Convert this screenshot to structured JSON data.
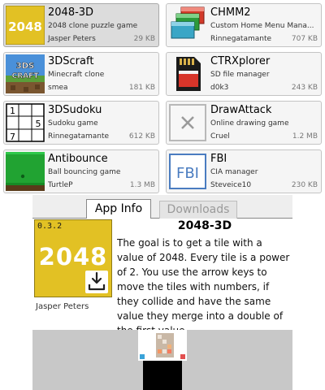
{
  "apps": [
    {
      "title": "2048-3D",
      "description": "2048 clone puzzle game",
      "author": "Jasper Peters",
      "size": "29 KB",
      "icon": "2048-icon",
      "icon_text": "2048",
      "selected": true
    },
    {
      "title": "CHMM2",
      "description": "Custom Home Menu Mana...",
      "author": "Rinnegatamante",
      "size": "707 KB",
      "icon": "chmm2-windows-icon"
    },
    {
      "title": "3DScraft",
      "description": "Minecraft clone",
      "author": "smea",
      "size": "181 KB",
      "icon": "3dscraft-icon",
      "icon_text": "3DS CRAFT"
    },
    {
      "title": "CTRXplorer",
      "description": "SD file manager",
      "author": "d0k3",
      "size": "243 KB",
      "icon": "sd-card-icon"
    },
    {
      "title": "3DSudoku",
      "description": "Sudoku game",
      "author": "Rinnegatamante",
      "size": "612 KB",
      "icon": "sudoku-grid-icon",
      "icon_digits": [
        "1",
        "5",
        "7"
      ]
    },
    {
      "title": "DrawAttack",
      "description": "Online drawing game",
      "author": "Cruel",
      "size": "1.2 MB",
      "icon": "placeholder-x-icon"
    },
    {
      "title": "Antibounce",
      "description": "Ball bouncing game",
      "author": "TurtleP",
      "size": "1.3 MB",
      "icon": "antibounce-icon"
    },
    {
      "title": "FBI",
      "description": "CIA manager",
      "author": "Steveice10",
      "size": "230 KB",
      "icon": "fbi-icon",
      "icon_text": "FBI"
    }
  ],
  "tabs": {
    "app_info": "App Info",
    "downloads": "Downloads"
  },
  "info": {
    "title": "2048-3D",
    "version": "0.3.2",
    "icon_text": "2048",
    "author": "Jasper Peters",
    "description": "The goal is to get a tile with a value of 2048. Every tile is a power of 2. You use the arrow keys to move the tiles with numbers, if they collide and have the same value they merge into a double of the first value."
  },
  "colors": {
    "accent_yellow": "#e2c124",
    "selected_card": "#dcdcdc",
    "card_bg": "#f5f5f5",
    "tab_inactive_text": "#9a9a9a"
  }
}
